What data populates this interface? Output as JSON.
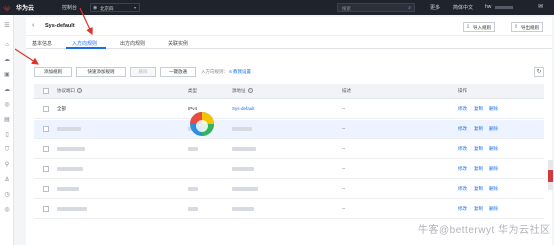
{
  "topbar": {
    "brand": "华为云",
    "console": "控制台",
    "region": "北京四",
    "search_placeholder": "搜索",
    "links": [
      "更多",
      "简体中文"
    ],
    "user": "hw"
  },
  "page": {
    "title": "Sys-default",
    "import_rules": "导入规则",
    "export_rules": "导出规则"
  },
  "tabs": [
    {
      "label": "基本信息"
    },
    {
      "label": "入方向规则"
    },
    {
      "label": "出方向规则"
    },
    {
      "label": "关联实例"
    }
  ],
  "toolbar": {
    "add_rule": "添加规则",
    "quick_add_rule": "快速添加规则",
    "delete": "删除",
    "one_click_allow": "一键放通",
    "info_prefix": "入方向规则：",
    "rule_count": "6",
    "info_link": "教我设置"
  },
  "table": {
    "columns": {
      "protocol_port": "协议端口",
      "type": "类型",
      "source": "源地址",
      "description": "描述",
      "actions": "操作"
    },
    "ops": {
      "modify": "修改",
      "copy": "复制",
      "delete": "删除"
    },
    "rows": [
      {
        "protocol_port": "全部",
        "type": "IPv4",
        "source": "Sys-default",
        "description": "--"
      },
      {
        "protocol_port": "",
        "type": "",
        "source": "",
        "description": "--"
      },
      {
        "protocol_port": "",
        "type": "",
        "source": "",
        "description": "--"
      },
      {
        "protocol_port": "",
        "type": "",
        "source": "",
        "description": "--"
      },
      {
        "protocol_port": "",
        "type": "",
        "source": "",
        "description": "--"
      },
      {
        "protocol_port": "",
        "type": "",
        "source": "",
        "description": "--"
      }
    ]
  },
  "watermark": "牛客@betterwyt 华为云社区",
  "colors": {
    "topbar": "#1f232b",
    "accent": "#1a6fe8",
    "annotation_arrow": "#e0332a"
  }
}
